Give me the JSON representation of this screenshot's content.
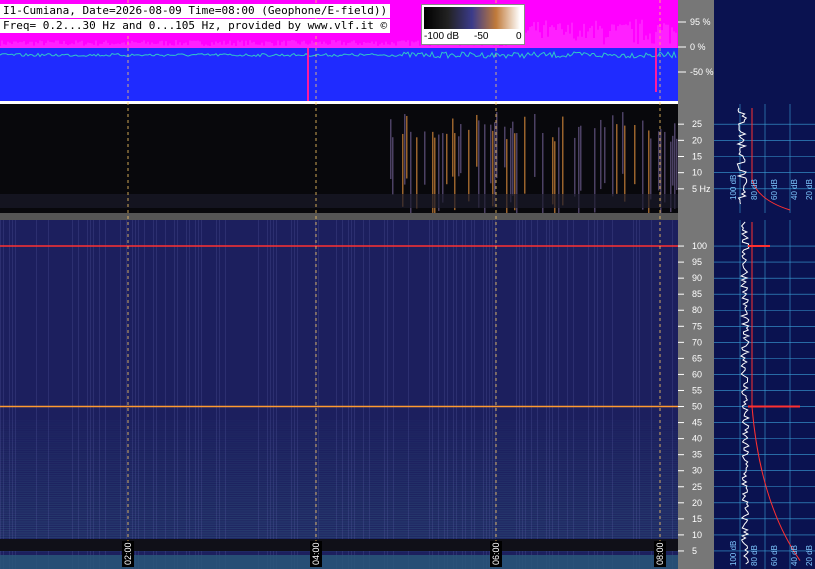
{
  "header": {
    "line1": "I1-Cumiana, Date=2026-08-09 Time=08:00 (Geophone/E-field))",
    "line2": "Freq= 0.2...30 Hz and 0...105 Hz, provided by www.vlf.it ©"
  },
  "scale": {
    "labels": [
      "-100 dB",
      "-50",
      "0"
    ]
  },
  "colors": {
    "top_bg": "#ff00ff",
    "mid_bg": "#1f2bff",
    "trace": "#30c8c8",
    "spectro_bg": "#1c1f5e",
    "panel_bg": "#0a1250",
    "axis_bg": "#777777",
    "marker": "#ff3030",
    "guide": "#ffcc66"
  },
  "chart_data": [
    {
      "type": "line",
      "name": "amplitude strip",
      "ylabel_ticks": [
        "95 %",
        "0 %",
        "-50 %"
      ],
      "y_values": [
        95,
        0,
        -50
      ]
    },
    {
      "type": "heatmap",
      "name": "geophone spectrogram 0.2-30 Hz",
      "yticks": [
        25,
        20,
        15,
        10,
        5
      ],
      "ytick_labels": [
        "25",
        "20",
        "15",
        "10",
        "5 Hz"
      ],
      "ylim": [
        0.2,
        30
      ],
      "side_panel_labels": [
        "100 dB",
        "80 dB",
        "60 dB",
        "40 dB",
        "20 dB"
      ]
    },
    {
      "type": "heatmap",
      "name": "E-field spectrogram 0-105 Hz",
      "yticks": [
        100,
        95,
        90,
        85,
        80,
        75,
        70,
        65,
        60,
        55,
        50,
        45,
        40,
        35,
        30,
        25,
        20,
        15,
        10,
        5
      ],
      "ylim": [
        0,
        105
      ],
      "xticks": [
        "02:00",
        "04:00",
        "06:00",
        "08:00"
      ],
      "side_panel_labels": [
        "100 dB",
        "80 dB",
        "60 dB",
        "40 dB",
        "20 dB"
      ],
      "lines": [
        {
          "name": "50 Hz",
          "value": 50
        },
        {
          "name": "100 Hz",
          "value": 100
        }
      ]
    }
  ]
}
